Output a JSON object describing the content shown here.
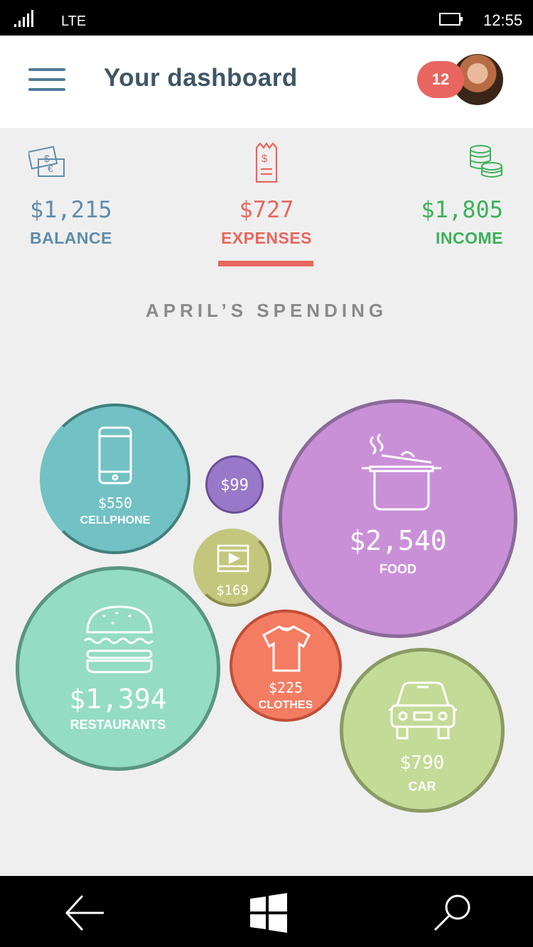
{
  "status_bar": {
    "network": "LTE",
    "time": "12:55"
  },
  "header": {
    "title": "Your dashboard",
    "notification_count": "12"
  },
  "summary": [
    {
      "value": "$1,215",
      "label": "BALANCE",
      "icon": "banknotes-icon",
      "color": "#5f8cab"
    },
    {
      "value": "$727",
      "label": "EXPENSES",
      "icon": "receipt-icon",
      "color": "#e8665f",
      "selected": true
    },
    {
      "value": "$1,805",
      "label": "INCOME",
      "icon": "coins-icon",
      "color": "#3bb15a"
    }
  ],
  "section_title": "APRIL’S SPENDING",
  "categories": [
    {
      "id": "cellphone",
      "value": "$550",
      "label": "CELLPHONE",
      "icon": "phone-icon",
      "fill": "#72c1c4",
      "ring": "#3f7f7c"
    },
    {
      "id": "other",
      "value": "$99",
      "label": "",
      "fill": "#9a78c9",
      "ring": "#6a4f96"
    },
    {
      "id": "food",
      "value": "$2,540",
      "label": "FOOD",
      "icon": "pot-icon",
      "fill": "#c990d8",
      "ring": "#8b6a9a"
    },
    {
      "id": "movies",
      "value": "$169",
      "label": "",
      "icon": "film-icon",
      "fill": "#c3c77e",
      "ring": "#8a8c4c"
    },
    {
      "id": "restaurants",
      "value": "$1,394",
      "label": "RESTAURANTS",
      "icon": "burger-icon",
      "fill": "#94dcc3",
      "ring": "#5a9583"
    },
    {
      "id": "clothes",
      "value": "$225",
      "label": "CLOTHES",
      "icon": "tshirt-icon",
      "fill": "#f47c62",
      "ring": "#c24e37"
    },
    {
      "id": "car",
      "value": "$790",
      "label": "CAR",
      "icon": "car-icon",
      "fill": "#c4da97",
      "ring": "#8a9a62"
    }
  ]
}
